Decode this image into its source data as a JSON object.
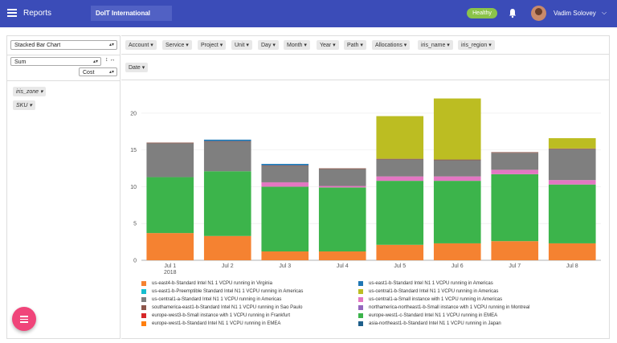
{
  "header": {
    "app_title": "Reports",
    "org": "DoIT International",
    "status": "Healthy",
    "user": "Vadim Solovey",
    "menu_icon": "menu-icon",
    "bell_icon": "bell-icon",
    "colors": {
      "bar": "#3b4cb8",
      "healthy": "#8bc34a",
      "fab": "#f0457a"
    }
  },
  "controls": {
    "chart_type": "Stacked Bar Chart",
    "aggregator": "Sum",
    "value": "Cost",
    "swap_icon": "swap-icon"
  },
  "column_fields": [
    "Account",
    "Service",
    "Project",
    "Unit",
    "Day",
    "Month",
    "Year",
    "Path",
    "Allocations",
    "iris_name",
    "iris_region"
  ],
  "row_fields": [
    "Date"
  ],
  "side_fields": [
    "iris_zone",
    "SKU"
  ],
  "chart_data": {
    "type": "bar",
    "stacked": true,
    "categories": [
      "Jul 1",
      "Jul 2",
      "Jul 3",
      "Jul 4",
      "Jul 5",
      "Jul 6",
      "Jul 7",
      "Jul 8"
    ],
    "first_tick_sub": "2018",
    "yticks": [
      0,
      5,
      10,
      15,
      20
    ],
    "ylim": [
      0,
      22.5
    ],
    "series": [
      {
        "name": "us-east4-b-Standard Intel N1 1 VCPU running in Virginia",
        "color": "#f58231",
        "values": [
          3.7,
          3.3,
          1.2,
          1.2,
          2.1,
          2.3,
          2.6,
          2.3
        ]
      },
      {
        "name": "europe-west1-c-Standard Intel N1 1 VCPU running in EMEA",
        "color": "#3cb44b",
        "values": [
          7.6,
          8.8,
          8.8,
          8.7,
          8.7,
          8.5,
          9.1,
          8.0
        ]
      },
      {
        "name": "us-central1-a-Small instance with 1 VCPU running in Americas",
        "color": "#e377c2",
        "values": [
          0.0,
          0.0,
          0.6,
          0.2,
          0.6,
          0.6,
          0.6,
          0.6
        ]
      },
      {
        "name": "us-central1-a-Standard Intel N1 1 VCPU running in Americas",
        "color": "#7f7f7f",
        "values": [
          4.6,
          4.0,
          2.2,
          2.3,
          2.3,
          2.2,
          2.3,
          4.2
        ]
      },
      {
        "name": "southamerica-east1-b-Standard Intel N1 1 VCPU running in Sao Paulo",
        "color": "#8c564b",
        "values": [
          0.1,
          0.1,
          0.1,
          0.1,
          0.1,
          0.1,
          0.1,
          0.1
        ]
      },
      {
        "name": "us-east1-b-Standard Intel N1 1 VCPU running in Americas",
        "color": "#1f77b4",
        "values": [
          0.0,
          0.2,
          0.2,
          0.0,
          0.0,
          0.0,
          0.0,
          0.0
        ]
      },
      {
        "name": "us-central1-b-Standard Intel N1 1 VCPU running in Americas",
        "color": "#bcbd22",
        "values": [
          0.0,
          0.0,
          0.0,
          0.0,
          5.8,
          8.3,
          0.0,
          1.4
        ]
      }
    ]
  },
  "legend": [
    {
      "label": "us-east4-b-Standard Intel N1 1 VCPU running in Virginia",
      "color": "#f58231"
    },
    {
      "label": "us-east1-b-Standard Intel N1 1 VCPU running in Americas",
      "color": "#1f77b4"
    },
    {
      "label": "us-east1-b-Preemptible Standard Intel N1 1 VCPU running in Americas",
      "color": "#17becf"
    },
    {
      "label": "us-central1-b-Standard Intel N1 1 VCPU running in Americas",
      "color": "#bcbd22"
    },
    {
      "label": "us-central1-a-Standard Intel N1 1 VCPU running in Americas",
      "color": "#7f7f7f"
    },
    {
      "label": "us-central1-a-Small instance with 1 VCPU running in Americas",
      "color": "#e377c2"
    },
    {
      "label": "southamerica-east1-b-Standard Intel N1 1 VCPU running in Sao Paulo",
      "color": "#8c564b"
    },
    {
      "label": "northamerica-northeast1-b-Small instance with 1 VCPU running in Montreal",
      "color": "#9467bd"
    },
    {
      "label": "europe-west3-b-Small instance with 1 VCPU running in Frankfurt",
      "color": "#d62728"
    },
    {
      "label": "europe-west1-c-Standard Intel N1 1 VCPU running in EMEA",
      "color": "#3cb44b"
    },
    {
      "label": "europe-west1-b-Standard Intel N1 1 VCPU running in EMEA",
      "color": "#ff7f0e"
    },
    {
      "label": "asia-northeast1-b-Standard Intel N1 1 VCPU running in Japan",
      "color": "#1f5f8b"
    }
  ],
  "fab_icon": "menu-icon"
}
